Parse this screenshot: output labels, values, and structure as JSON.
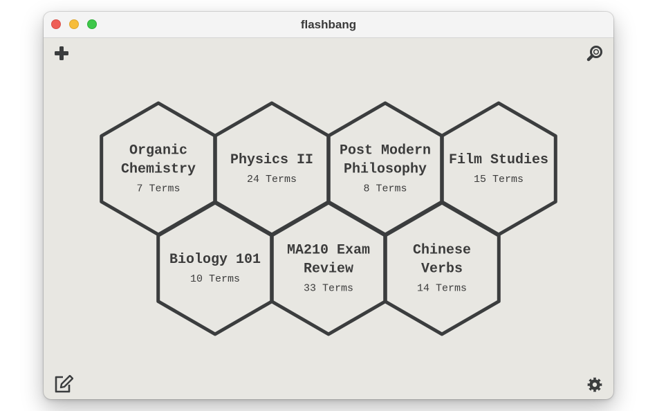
{
  "window": {
    "title": "flashbang"
  },
  "toolbar": {
    "add_icon": "plus-icon",
    "search_icon": "search-icon",
    "edit_icon": "edit-icon",
    "settings_icon": "gear-icon"
  },
  "decks": [
    {
      "name": "Organic Chemistry",
      "count": "7 Terms"
    },
    {
      "name": "Physics II",
      "count": "24 Terms"
    },
    {
      "name": "Post Modern Philosophy",
      "count": "8 Terms"
    },
    {
      "name": "Film Studies",
      "count": "15 Terms"
    },
    {
      "name": "Biology 101",
      "count": "10 Terms"
    },
    {
      "name": "MA210 Exam Review",
      "count": "33 Terms"
    },
    {
      "name": "Chinese Verbs",
      "count": "14 Terms"
    }
  ],
  "colors": {
    "hex_stroke": "#3b3d3e",
    "background": "#e8e7e2"
  }
}
